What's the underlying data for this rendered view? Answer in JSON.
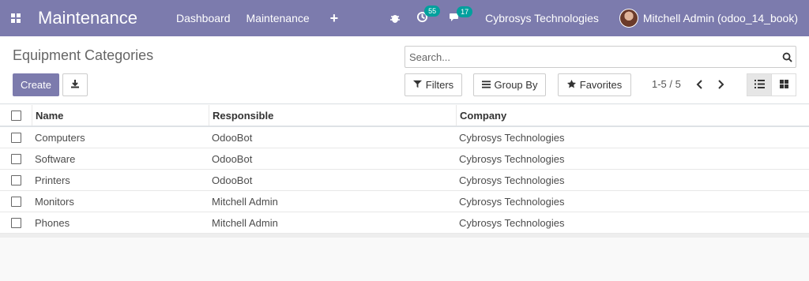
{
  "navbar": {
    "app_title": "Maintenance",
    "menu": [
      "Dashboard",
      "Maintenance"
    ],
    "activity_badge": "55",
    "message_badge": "17",
    "company": "Cybrosys Technologies",
    "user": "Mitchell Admin (odoo_14_book)"
  },
  "control_panel": {
    "breadcrumb": "Equipment Categories",
    "search_placeholder": "Search...",
    "create_label": "Create",
    "filters_label": "Filters",
    "groupby_label": "Group By",
    "favorites_label": "Favorites",
    "pager": "1-5 / 5"
  },
  "table": {
    "columns": [
      "Name",
      "Responsible",
      "Company"
    ],
    "rows": [
      [
        "Computers",
        "OdooBot",
        "Cybrosys Technologies"
      ],
      [
        "Software",
        "OdooBot",
        "Cybrosys Technologies"
      ],
      [
        "Printers",
        "OdooBot",
        "Cybrosys Technologies"
      ],
      [
        "Monitors",
        "Mitchell Admin",
        "Cybrosys Technologies"
      ],
      [
        "Phones",
        "Mitchell Admin",
        "Cybrosys Technologies"
      ]
    ]
  },
  "icons": {
    "apps": "apps-grid-icon",
    "debug": "bug-icon",
    "activity": "clock-icon",
    "messages": "chat-icon",
    "search": "search-icon",
    "download": "download-icon",
    "filter": "filter-icon",
    "groupby": "bars-icon",
    "favorites": "star-icon",
    "list_view": "list-icon",
    "kanban_view": "kanban-icon"
  },
  "colors": {
    "brand": "#7c7bad",
    "badge": "#00a09d"
  }
}
